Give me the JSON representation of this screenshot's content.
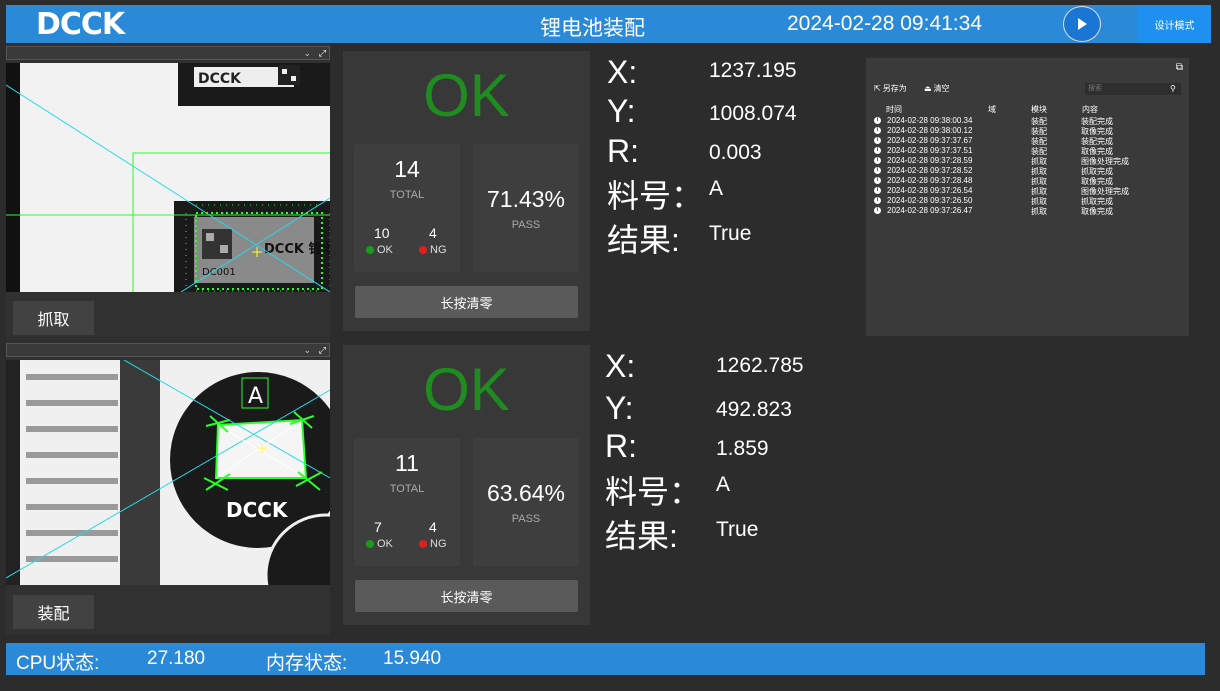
{
  "header": {
    "logo": "DCCK",
    "title": "锂电池装配",
    "datetime": "2024-02-28 09:41:34",
    "design_mode": "设计模式"
  },
  "stations": [
    {
      "action_label": "抓取",
      "status": "OK",
      "total": "14",
      "total_label": "TOTAL",
      "ok_count": "10",
      "ok_label": "OK",
      "ng_count": "4",
      "ng_label": "NG",
      "pass_rate": "71.43%",
      "pass_label": "PASS",
      "reset_label": "长按清零",
      "x_label": "X:",
      "x": "1237.195",
      "y_label": "Y:",
      "y": "1008.074",
      "r_label": "R:",
      "r": "0.003",
      "part_label": "料号：",
      "part": "A",
      "result_label": "结果:",
      "result": "True"
    },
    {
      "action_label": "装配",
      "status": "OK",
      "total": "11",
      "total_label": "TOTAL",
      "ok_count": "7",
      "ok_label": "OK",
      "ng_count": "4",
      "ng_label": "NG",
      "pass_rate": "63.64%",
      "pass_label": "PASS",
      "reset_label": "长按清零",
      "x_label": "X:",
      "x": "1262.785",
      "y_label": "Y:",
      "y": "492.823",
      "r_label": "R:",
      "r": "1.859",
      "part_label": "料号：",
      "part": "A",
      "result_label": "结果:",
      "result": "True"
    }
  ],
  "log": {
    "save_as": "另存为",
    "clear": "清空",
    "search_placeholder": "搜索",
    "columns": [
      "时间",
      "域",
      "模块",
      "内容"
    ],
    "rows": [
      {
        "time": "2024-02-28 09:38:00.34",
        "module": "装配",
        "content": "装配完成"
      },
      {
        "time": "2024-02-28 09:38:00.12",
        "module": "装配",
        "content": "取像完成"
      },
      {
        "time": "2024-02-28 09:37:37.67",
        "module": "装配",
        "content": "装配完成"
      },
      {
        "time": "2024-02-28 09:37:37.51",
        "module": "装配",
        "content": "取像完成"
      },
      {
        "time": "2024-02-28 09:37:28.59",
        "module": "抓取",
        "content": "图像处理完成"
      },
      {
        "time": "2024-02-28 09:37:28.52",
        "module": "抓取",
        "content": "抓取完成"
      },
      {
        "time": "2024-02-28 09:37:28.48",
        "module": "抓取",
        "content": "取像完成"
      },
      {
        "time": "2024-02-28 09:37:26.54",
        "module": "抓取",
        "content": "图像处理完成"
      },
      {
        "time": "2024-02-28 09:37:26.50",
        "module": "抓取",
        "content": "抓取完成"
      },
      {
        "time": "2024-02-28 09:37:26.47",
        "module": "抓取",
        "content": "取像完成"
      }
    ]
  },
  "footer": {
    "cpu_label": "CPU状态:",
    "cpu_value": "27.180",
    "mem_label": "内存状态:",
    "mem_value": "15.940"
  },
  "camera_images": {
    "top_code_text": "DC001",
    "top_label_text": "DCCK 锂电",
    "bottom_letter": "A",
    "bottom_logo": "DCCK"
  },
  "colors": {
    "accent": "#2a8ad8",
    "ok_green": "#1e8c1e",
    "ok_dot": "#1c9a1c",
    "ng_dot": "#e02020"
  }
}
